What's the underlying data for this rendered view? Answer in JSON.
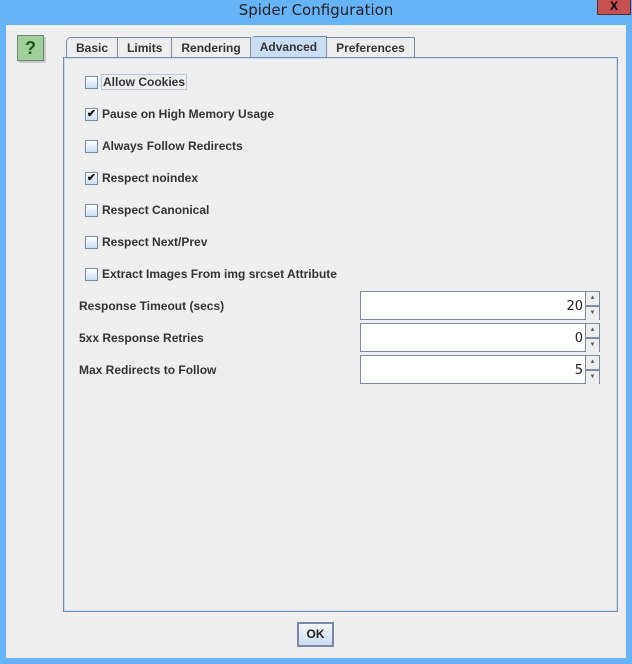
{
  "window": {
    "title": "Spider Configuration",
    "close_label": "X"
  },
  "help_button": {
    "label": "?"
  },
  "tabs": [
    {
      "label": "Basic",
      "active": false
    },
    {
      "label": "Limits",
      "active": false
    },
    {
      "label": "Rendering",
      "active": false
    },
    {
      "label": "Advanced",
      "active": true
    },
    {
      "label": "Preferences",
      "active": false
    }
  ],
  "options": [
    {
      "label": "Allow Cookies",
      "checked": false,
      "focused": true
    },
    {
      "label": "Pause on High Memory Usage",
      "checked": true
    },
    {
      "label": "Always Follow Redirects",
      "checked": false
    },
    {
      "label": "Respect noindex",
      "checked": true
    },
    {
      "label": "Respect Canonical",
      "checked": false
    },
    {
      "label": "Respect Next/Prev",
      "checked": false
    },
    {
      "label": "Extract Images From img srcset Attribute",
      "checked": false
    }
  ],
  "fields": [
    {
      "label": "Response Timeout (secs)",
      "value": "20"
    },
    {
      "label": "5xx Response Retries",
      "value": "0"
    },
    {
      "label": "Max Redirects to Follow",
      "value": "5"
    }
  ],
  "icons": {
    "check": "✔",
    "spin_up": "▲",
    "spin_down": "▼"
  },
  "ok_button": {
    "label": "OK"
  }
}
